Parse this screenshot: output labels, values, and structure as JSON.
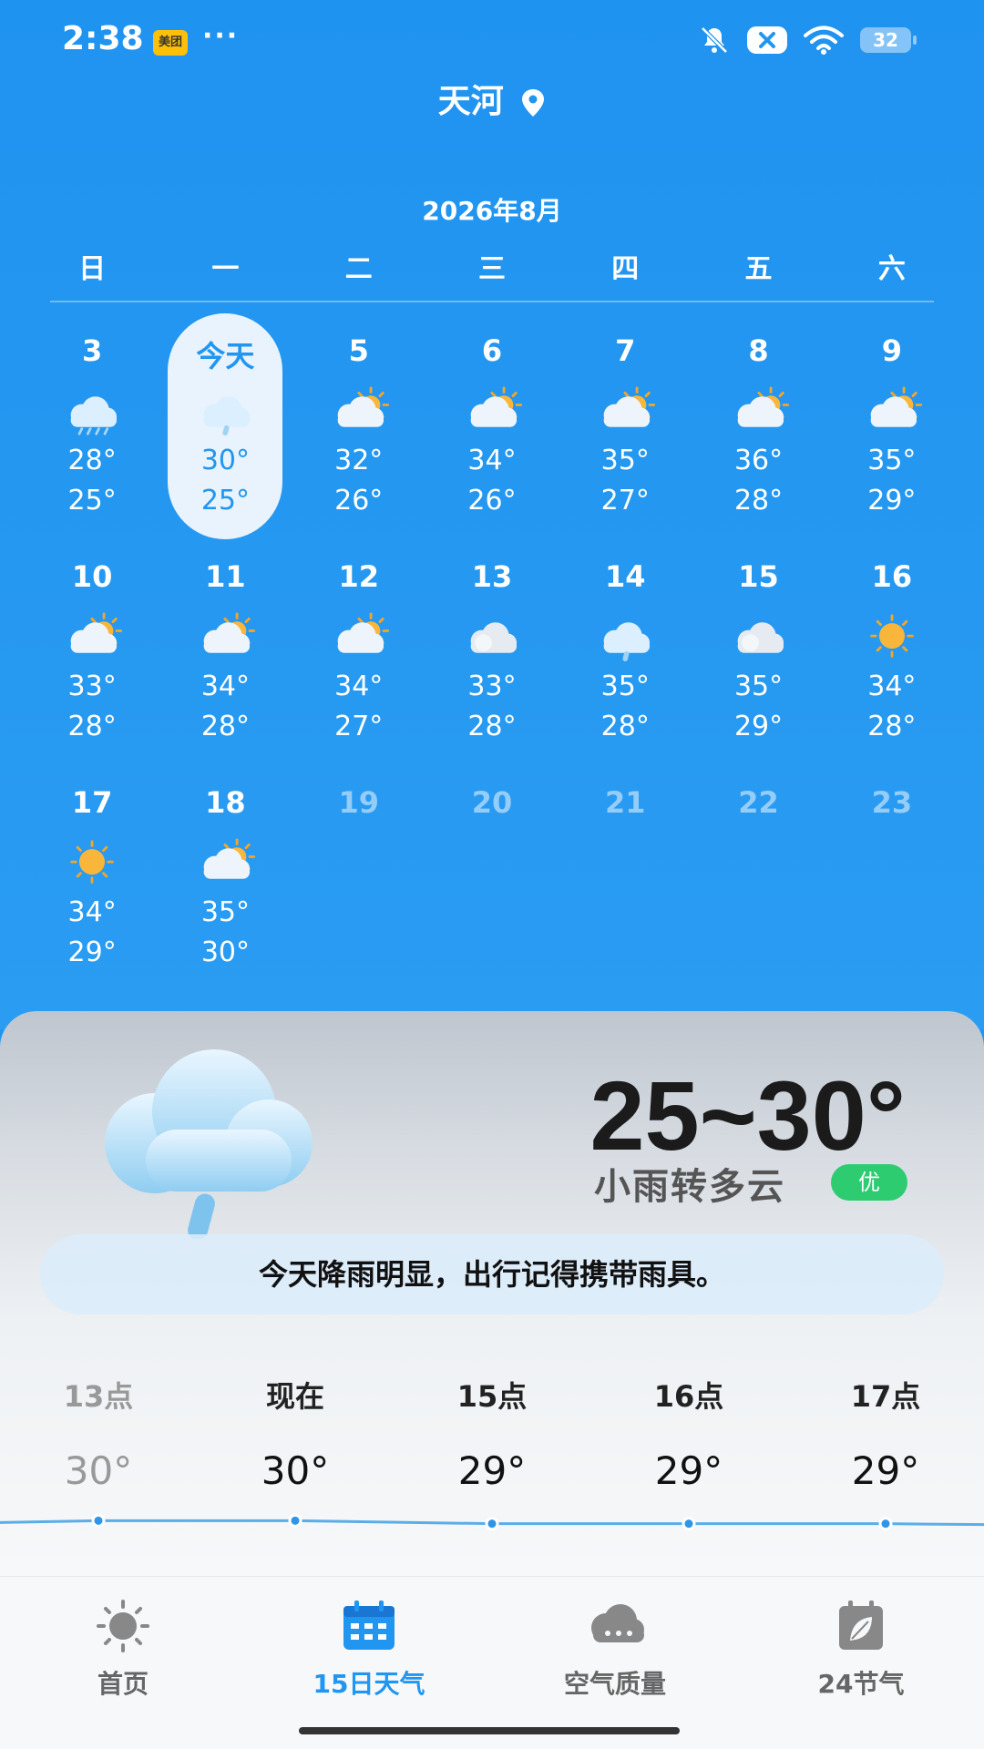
{
  "status_bar": {
    "time": "2:38",
    "app_badge": "美团",
    "dots": "···",
    "battery": "32"
  },
  "location": {
    "name": "天河"
  },
  "calendar": {
    "month_title": "2026年8月",
    "weekdays": [
      "日",
      "一",
      "二",
      "三",
      "四",
      "五",
      "六"
    ],
    "weeks": [
      [
        {
          "day": "3",
          "icon": "rain-cloud-icon",
          "hi": "28°",
          "lo": "25°"
        },
        {
          "day": "今天",
          "icon": "light-rain-cloud-icon",
          "hi": "30°",
          "lo": "25°",
          "today": true
        },
        {
          "day": "5",
          "icon": "partly-cloudy-icon",
          "hi": "32°",
          "lo": "26°"
        },
        {
          "day": "6",
          "icon": "partly-cloudy-icon",
          "hi": "34°",
          "lo": "26°"
        },
        {
          "day": "7",
          "icon": "partly-cloudy-icon",
          "hi": "35°",
          "lo": "27°"
        },
        {
          "day": "8",
          "icon": "partly-cloudy-icon",
          "hi": "36°",
          "lo": "28°"
        },
        {
          "day": "9",
          "icon": "partly-cloudy-icon",
          "hi": "35°",
          "lo": "29°"
        }
      ],
      [
        {
          "day": "10",
          "icon": "partly-cloudy-icon",
          "hi": "33°",
          "lo": "28°"
        },
        {
          "day": "11",
          "icon": "partly-cloudy-icon",
          "hi": "34°",
          "lo": "28°"
        },
        {
          "day": "12",
          "icon": "partly-cloudy-icon",
          "hi": "34°",
          "lo": "27°"
        },
        {
          "day": "13",
          "icon": "cloudy-icon",
          "hi": "33°",
          "lo": "28°"
        },
        {
          "day": "14",
          "icon": "light-rain-cloud-icon",
          "hi": "35°",
          "lo": "28°"
        },
        {
          "day": "15",
          "icon": "cloudy-icon",
          "hi": "35°",
          "lo": "29°"
        },
        {
          "day": "16",
          "icon": "sunny-icon",
          "hi": "34°",
          "lo": "28°"
        }
      ],
      [
        {
          "day": "17",
          "icon": "sunny-icon",
          "hi": "34°",
          "lo": "29°"
        },
        {
          "day": "18",
          "icon": "partly-cloudy-icon",
          "hi": "35°",
          "lo": "30°"
        },
        {
          "day": "19",
          "future": true
        },
        {
          "day": "20",
          "future": true
        },
        {
          "day": "21",
          "future": true
        },
        {
          "day": "22",
          "future": true
        },
        {
          "day": "23",
          "future": true
        }
      ]
    ]
  },
  "today_card": {
    "temp_range": "25~30°",
    "condition": "小雨转多云",
    "air_quality": "优",
    "tip": "今天降雨明显，出行记得携带雨具。"
  },
  "hourly": [
    {
      "label": "13点",
      "temp": "30°",
      "value": 30,
      "past": true
    },
    {
      "label": "现在",
      "temp": "30°",
      "value": 30
    },
    {
      "label": "15点",
      "temp": "29°",
      "value": 29
    },
    {
      "label": "16点",
      "temp": "29°",
      "value": 29
    },
    {
      "label": "17点",
      "temp": "29°",
      "value": 29
    }
  ],
  "nav": [
    {
      "label": "首页",
      "icon": "sun-icon"
    },
    {
      "label": "15日天气",
      "icon": "calendar-icon",
      "active": true
    },
    {
      "label": "空气质量",
      "icon": "cloud-aqi-icon"
    },
    {
      "label": "24节气",
      "icon": "leaf-calendar-icon"
    }
  ],
  "colors": {
    "primary": "#2196F0",
    "aq_good": "#2ecc71"
  }
}
